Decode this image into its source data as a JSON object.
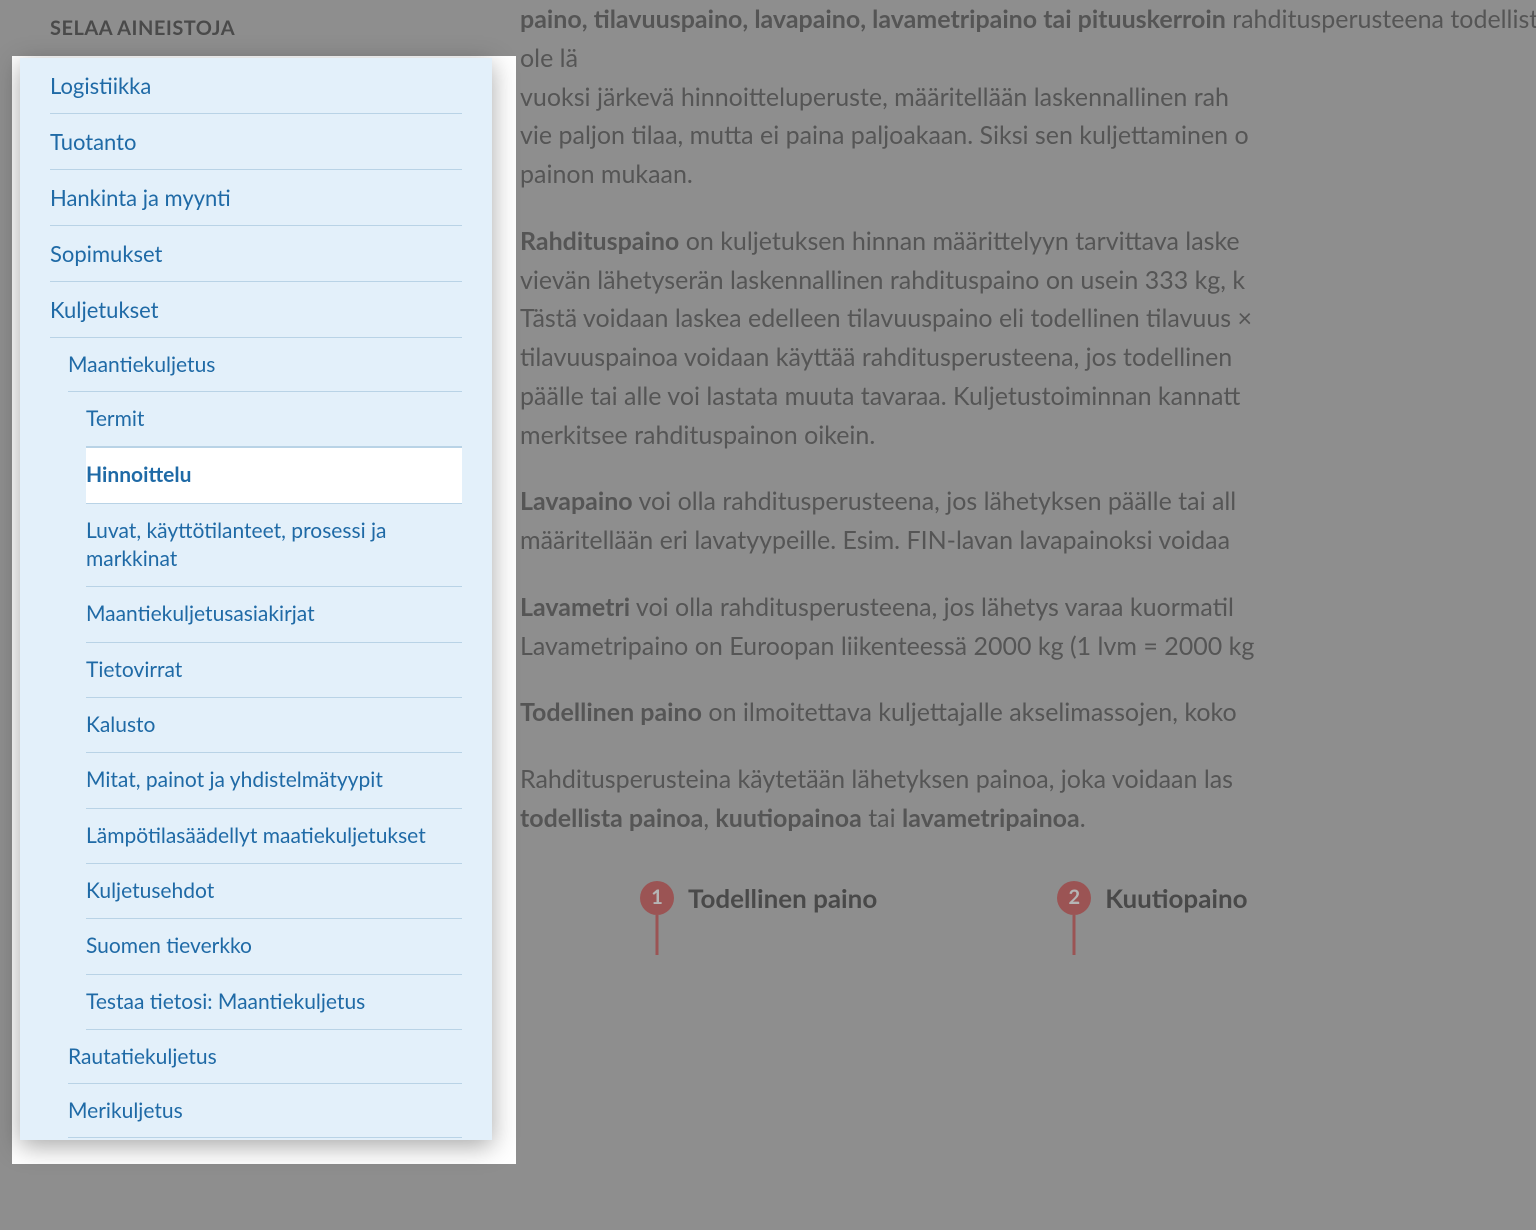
{
  "sidebar": {
    "header": "SELAA AINEISTOJA",
    "top": [
      {
        "label": "Logistiikka"
      },
      {
        "label": "Tuotanto"
      },
      {
        "label": "Hankinta ja myynti"
      },
      {
        "label": "Sopimukset"
      },
      {
        "label": "Kuljetukset"
      }
    ],
    "sub1_label": "Maantiekuljetus",
    "sub2": [
      {
        "label": "Termit"
      },
      {
        "label": "Hinnoittelu",
        "active": true
      },
      {
        "label": "Luvat, käyttötilanteet, prosessi ja markkinat"
      },
      {
        "label": "Maantiekuljetusasiakirjat"
      },
      {
        "label": "Tietovirrat"
      },
      {
        "label": "Kalusto"
      },
      {
        "label": "Mitat, painot ja yhdistelmätyypit"
      },
      {
        "label": "Lämpötilasäädellyt maatiekuljetukset"
      },
      {
        "label": "Kuljetusehdot"
      },
      {
        "label": "Suomen tieverkko"
      },
      {
        "label": "Testaa tietosi: Maantiekuljetus"
      }
    ],
    "tail": [
      {
        "label": "Rautatiekuljetus"
      },
      {
        "label": "Merikuljetus"
      }
    ]
  },
  "content": {
    "p1_bold": "paino, tilavuuspaino, lavapaino, lavametripaino tai pituuskerroin",
    "p1_rest_a": " rahditusperusteena todellista painoa. Jos todellinen paino ei ole lä",
    "p1_rest_b": "vuoksi järkevä hinnoitteluperuste, määritellään laskennallinen rah",
    "p1_rest_c": "vie paljon tilaa, mutta ei paina paljoakaan. Siksi sen kuljettaminen o",
    "p1_rest_d": "painon mukaan.",
    "p2_bold": "Rahdituspaino",
    "p2_a": " on kuljetuksen hinnan määrittelyyn tarvittava laske",
    "p2_b": "vievän lähetyserän laskennallinen rahdituspaino on usein 333 kg, k",
    "p2_c": "Tästä voidaan laskea edelleen tilavuuspaino eli todellinen tilavuus ×",
    "p2_d": "tilavuuspainoa voidaan käyttää rahditusperusteena, jos todellinen ",
    "p2_e": "päälle tai alle voi lastata muuta tavaraa. Kuljetustoiminnan kannatt",
    "p2_f": "merkitsee rahdituspainon oikein.",
    "p3_bold": "Lavapaino",
    "p3_a": " voi olla rahditusperusteena, jos lähetyksen päälle tai all",
    "p3_b": "määritellään eri lavatyypeille. Esim. FIN-lavan lavapainoksi voidaa",
    "p4_bold": "Lavametri",
    "p4_a": " voi olla rahditusperusteena, jos lähetys varaa kuormatil",
    "p4_b": "Lavametripaino on Euroopan liikenteessä 2000 kg (1 lvm = 2000 kg",
    "p5_bold": "Todellinen paino",
    "p5_a": " on ilmoitettava kuljettajalle akselimassojen, koko",
    "p6_a": "Rahditusperusteina käytetään lähetyksen painoa, joka voidaan las",
    "p6_b1": "todellista painoa",
    "p6_b2": ", ",
    "p6_b3": "kuutiopainoa",
    "p6_b4": " tai ",
    "p6_b5": "lavametripainoa",
    "p6_b6": ".",
    "fig": {
      "n1": "1",
      "l1": "Todellinen paino",
      "n2": "2",
      "l2": "Kuutiopaino"
    }
  }
}
